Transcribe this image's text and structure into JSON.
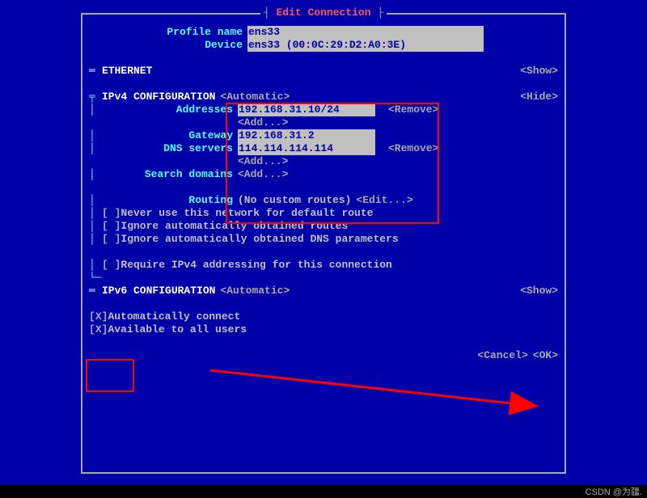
{
  "title": "Edit Connection",
  "profile": {
    "name_label": "Profile name",
    "name_value": "ens33",
    "device_label": "Device",
    "device_value": "ens33 (00:0C:29:D2:A0:3E)"
  },
  "ethernet": {
    "header": "ETHERNET",
    "action": "<Show>"
  },
  "ipv4": {
    "header": "IPv4 CONFIGURATION",
    "mode": "<Automatic>",
    "action": "<Hide>",
    "addresses_label": "Addresses",
    "addresses_value": "192.168.31.10/24",
    "addresses_remove": "<Remove>",
    "addresses_add": "<Add...>",
    "gateway_label": "Gateway",
    "gateway_value": "192.168.31.2",
    "dns_label": "DNS servers",
    "dns_value": "114.114.114.114",
    "dns_remove": "<Remove>",
    "dns_add": "<Add...>",
    "search_label": "Search domains",
    "search_add": "<Add...>",
    "routing_label": "Routing",
    "routing_value": "(No custom routes)",
    "routing_edit": "<Edit...>",
    "opt_never_default": "Never use this network for default route",
    "opt_ignore_routes": "Ignore automatically obtained routes",
    "opt_ignore_dns": "Ignore automatically obtained DNS parameters",
    "opt_require": "Require IPv4 addressing for this connection"
  },
  "ipv6": {
    "header": "IPv6 CONFIGURATION",
    "mode": "<Automatic>",
    "action": "<Show>"
  },
  "auto_connect": {
    "label": "Automatically connect",
    "checked": "X"
  },
  "all_users": {
    "label": "Available to all users",
    "checked": "X"
  },
  "buttons": {
    "cancel": "<Cancel>",
    "ok": "<OK>"
  },
  "watermark": "CSDN @为疆."
}
